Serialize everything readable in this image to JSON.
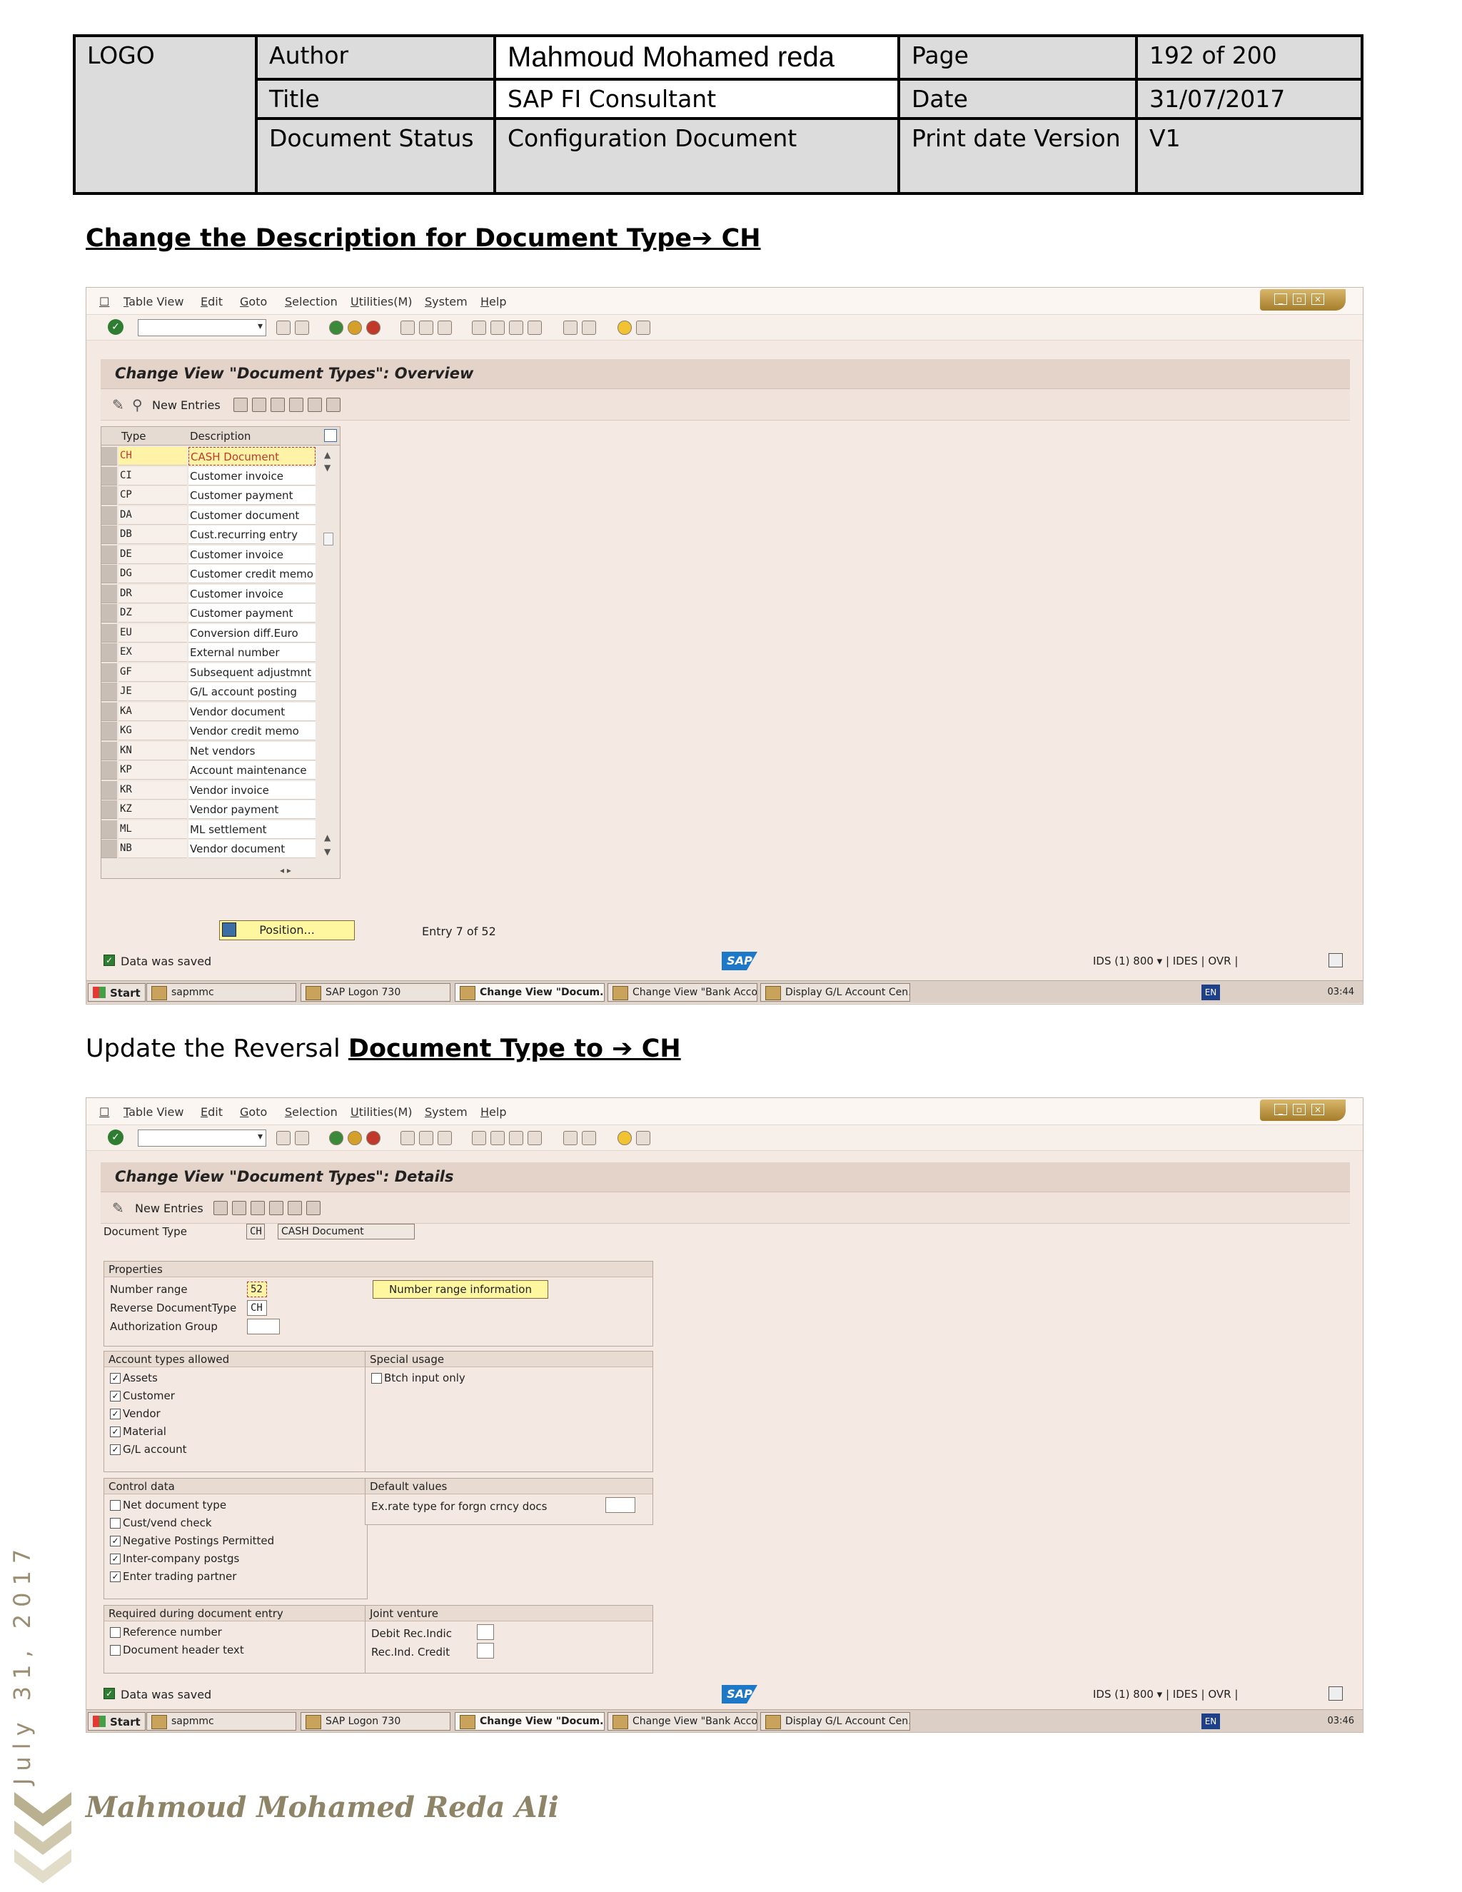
{
  "header": {
    "logo": "LOGO",
    "author_label": "Author",
    "author_value": "Mahmoud Mohamed reda",
    "page_label": "Page",
    "page_value": "192 of 200",
    "title_label": "Title",
    "title_value": "SAP FI Consultant",
    "date_label": "Date",
    "date_value": "31/07/2017",
    "status_label": "Document Status",
    "status_value": "Configuration Document",
    "print_label": "Print date Version",
    "print_value": "V1"
  },
  "heading1": "Change the Description for Document Type➔ CH",
  "heading2": {
    "prefix": "Update the Reversal ",
    "underlined": "Document Type to ➔ CH"
  },
  "menu": [
    "Table View",
    "Edit",
    "Goto",
    "Selection",
    "Utilities(M)",
    "System",
    "Help"
  ],
  "screen1": {
    "title": "Change View \"Document Types\": Overview",
    "new_entries": "New Entries",
    "col_type": "Type",
    "col_desc": "Description",
    "rows": [
      {
        "type": "CH",
        "desc": "CASH  Document"
      },
      {
        "type": "CI",
        "desc": "Customer invoice"
      },
      {
        "type": "CP",
        "desc": "Customer payment"
      },
      {
        "type": "DA",
        "desc": "Customer document"
      },
      {
        "type": "DB",
        "desc": "Cust.recurring entry"
      },
      {
        "type": "DE",
        "desc": "Customer invoice"
      },
      {
        "type": "DG",
        "desc": "Customer credit memo"
      },
      {
        "type": "DR",
        "desc": "Customer invoice"
      },
      {
        "type": "DZ",
        "desc": "Customer payment"
      },
      {
        "type": "EU",
        "desc": "Conversion diff.Euro"
      },
      {
        "type": "EX",
        "desc": "External number"
      },
      {
        "type": "GF",
        "desc": "Subsequent adjustmnt"
      },
      {
        "type": "JE",
        "desc": "G/L account posting"
      },
      {
        "type": "KA",
        "desc": "Vendor document"
      },
      {
        "type": "KG",
        "desc": "Vendor credit memo"
      },
      {
        "type": "KN",
        "desc": "Net vendors"
      },
      {
        "type": "KP",
        "desc": "Account maintenance"
      },
      {
        "type": "KR",
        "desc": "Vendor invoice"
      },
      {
        "type": "KZ",
        "desc": "Vendor payment"
      },
      {
        "type": "ML",
        "desc": "ML settlement"
      },
      {
        "type": "NB",
        "desc": "Vendor document"
      }
    ],
    "position_button": "Position...",
    "entry_info": "Entry 7 of 52",
    "status_msg": "Data was saved",
    "sys_info": "IDS (1) 800 ▾ | IDES | OVR |",
    "time": "03:44"
  },
  "screen2": {
    "title": "Change View \"Document Types\": Details",
    "new_entries": "New Entries",
    "doc_type_label": "Document Type",
    "doc_type_value": "CH",
    "doc_type_desc": "CASH  Document",
    "properties": "Properties",
    "number_range_label": "Number range",
    "number_range_value": "52",
    "nr_info_button": "Number range information",
    "reverse_label": "Reverse DocumentType",
    "reverse_value": "CH",
    "auth_label": "Authorization Group",
    "acct_types": "Account types allowed",
    "assets": "Assets",
    "customer": "Customer",
    "vendor": "Vendor",
    "material": "Material",
    "gl_account": "G/L account",
    "special_usage": "Special usage",
    "btch": "Btch input only",
    "control_data": "Control data",
    "net_doc": "Net document type",
    "cust_vend": "Cust/vend check",
    "neg_post": "Negative Postings Permitted",
    "inter_co": "Inter-company postgs",
    "trading": "Enter trading partner",
    "default_values": "Default values",
    "ex_rate": "Ex.rate type for forgn crncy docs",
    "required": "Required during document entry",
    "ref_num": "Reference number",
    "doc_header": "Document header text",
    "joint": "Joint venture",
    "debit": "Debit Rec.Indic",
    "credit": "Rec.Ind. Credit",
    "status_msg": "Data was saved",
    "sys_info": "IDS (1) 800 ▾ | IDES | OVR |",
    "time": "03:46"
  },
  "taskbar": {
    "start": "Start",
    "items": [
      "sapmmc",
      "SAP Logon 730",
      "Change View \"Docum...",
      "Change View \"Bank Acco...",
      "Display G/L Account Cen..."
    ],
    "lang": "EN"
  },
  "footer": {
    "side_date": "July 31, 2017",
    "signature": "Mahmoud Mohamed Reda Ali"
  }
}
